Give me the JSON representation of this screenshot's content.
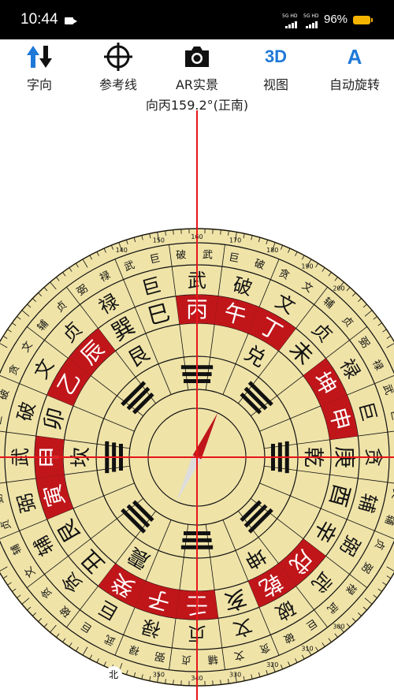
{
  "status": {
    "time": "10:44",
    "net1": "5G HD",
    "net2": "5G HD",
    "battery": "96%"
  },
  "toolbar": [
    {
      "label": "字向",
      "icon": "direction-arrows-icon"
    },
    {
      "label": "参考线",
      "icon": "crosshair-icon"
    },
    {
      "label": "AR实景",
      "icon": "camera-icon"
    },
    {
      "label": "视图",
      "icon_text": "3D"
    },
    {
      "label": "自动旋转",
      "icon_text": "A"
    }
  ],
  "heading": "向丙159.2°(正南)",
  "compass": {
    "north_label": "北",
    "bagua": [
      "乾",
      "坤",
      "震",
      "坎",
      "艮",
      "兑"
    ],
    "mountains": [
      [
        "巳",
        "丙",
        "午",
        "丁",
        "未",
        "坤",
        "申",
        "庚",
        "酉",
        "辛",
        "戌",
        "乾",
        "亥",
        "壬",
        "子",
        "癸",
        "丑",
        "艮",
        "寅",
        "甲",
        "卯",
        "乙",
        "辰",
        "巽"
      ]
    ],
    "stars": [
      "武",
      "破",
      "文",
      "贞",
      "禄",
      "巨",
      "贪",
      "辅",
      "弼"
    ],
    "degrees": [
      "140",
      "150",
      "160",
      "170",
      "180",
      "190",
      "200",
      "300",
      "310",
      "320",
      "330",
      "340",
      "350"
    ],
    "colors": {
      "face": "#efe3a8",
      "red": "#c0161a",
      "ink": "#111111"
    }
  }
}
